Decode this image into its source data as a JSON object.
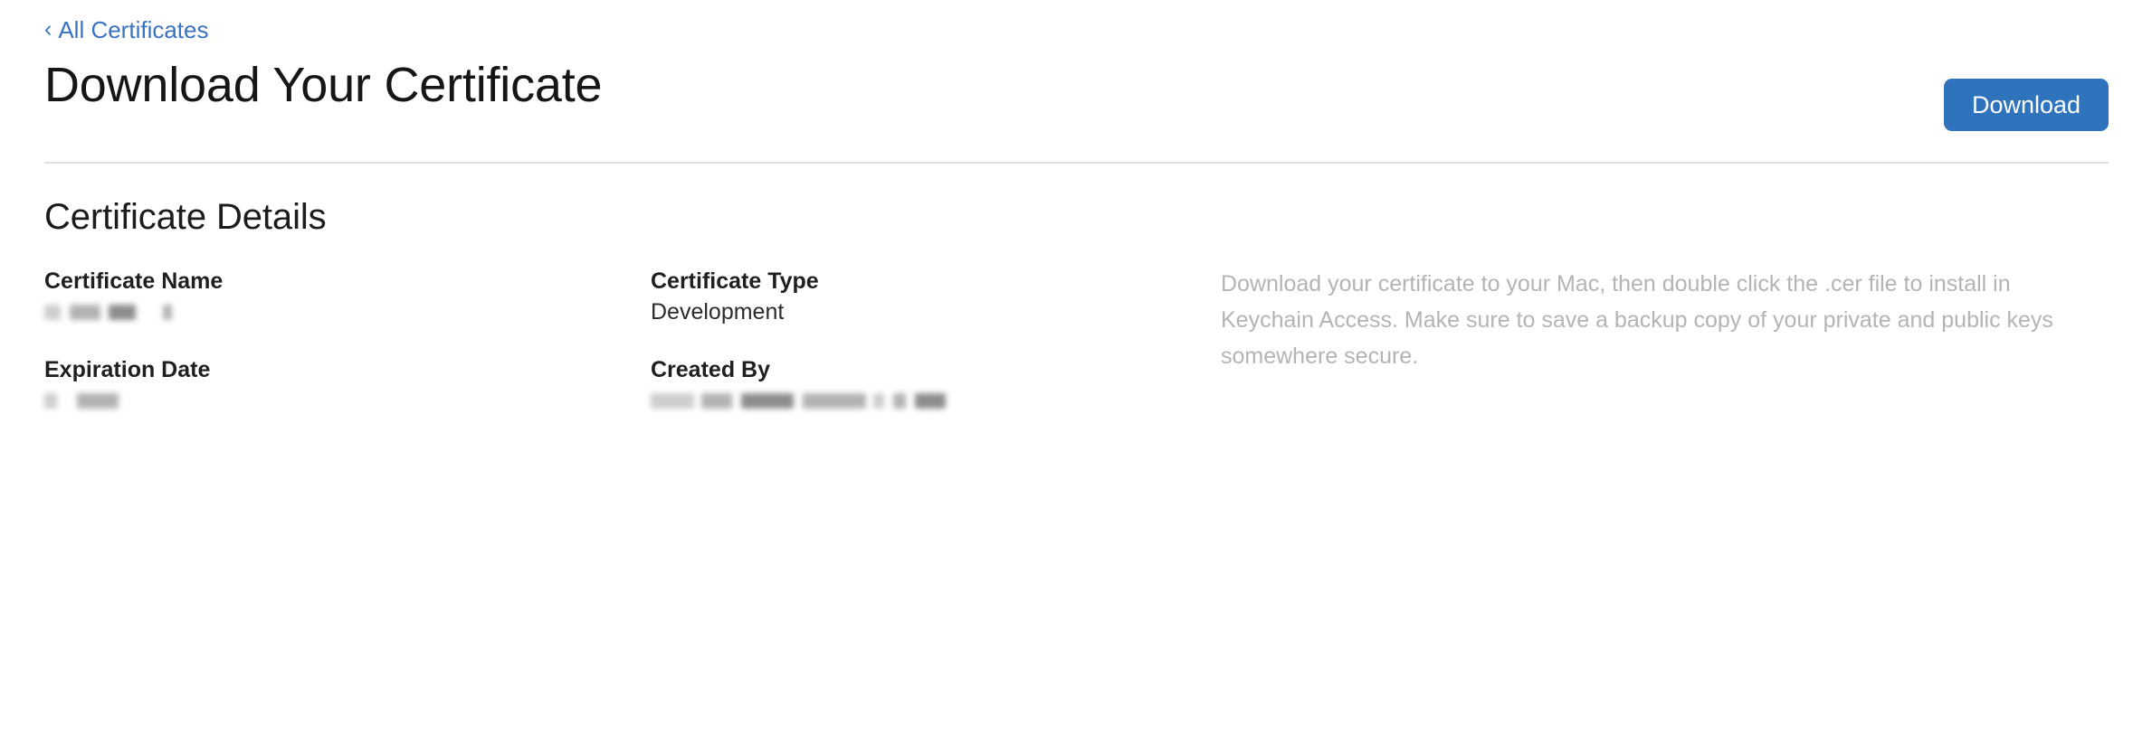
{
  "nav": {
    "back_link_label": "All Certificates",
    "back_chevron": "chevron-left-icon"
  },
  "header": {
    "title": "Download Your Certificate",
    "download_button_label": "Download"
  },
  "section": {
    "title": "Certificate Details"
  },
  "fields": {
    "certificate_name": {
      "label": "Certificate Name",
      "value": "",
      "redacted": true,
      "redaction_pattern": [
        18,
        10,
        34,
        9,
        30,
        30,
        10,
        12
      ]
    },
    "certificate_type": {
      "label": "Certificate Type",
      "value": "Development",
      "redacted": false
    },
    "expiration_date": {
      "label": "Expiration Date",
      "value": "",
      "redacted": true,
      "redaction_pattern": [
        14,
        22,
        46
      ]
    },
    "created_by": {
      "label": "Created By",
      "value": "",
      "redacted": true,
      "redaction_pattern": [
        48,
        8,
        34,
        10,
        58,
        10,
        70,
        8,
        12,
        10,
        14,
        10,
        34
      ]
    }
  },
  "help": {
    "text": "Download your certificate to your Mac, then double click the .cer file to install in Keychain Access. Make sure to save a backup copy of your private and public keys somewhere secure."
  },
  "colors": {
    "accent_blue": "#3073bd",
    "link_blue": "#3973c1",
    "divider": "#e0e0e0",
    "help_text": "#b4b4b4",
    "title": "#161616"
  }
}
